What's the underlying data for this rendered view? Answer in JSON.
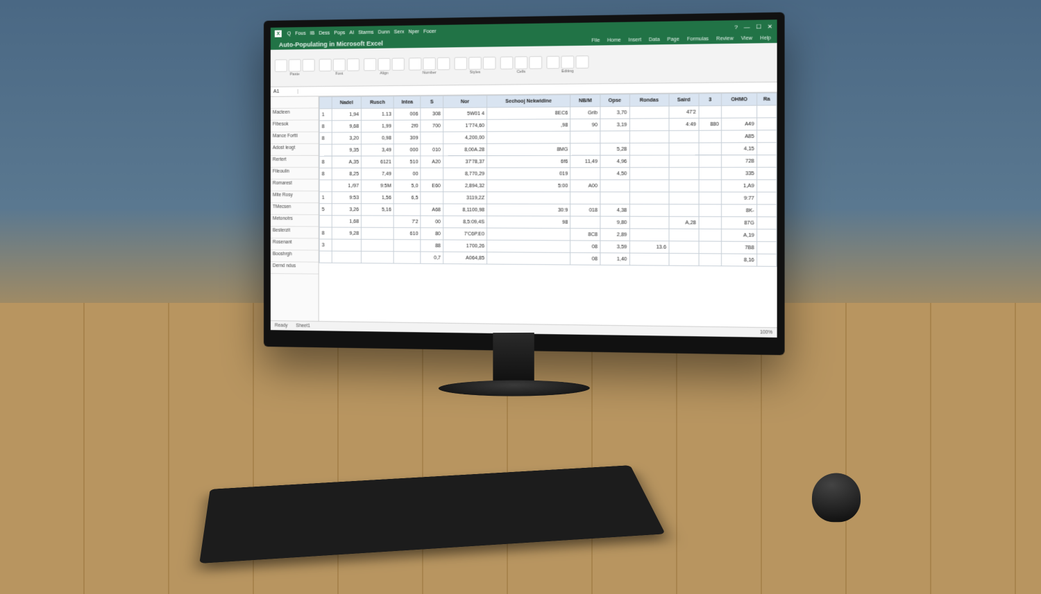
{
  "window": {
    "doc_title": "Auto-Populating in Microsoft Excel",
    "controls": {
      "min": "—",
      "max": "☐",
      "close": "✕",
      "help": "?"
    }
  },
  "menubar": [
    "File",
    "Home",
    "Insert",
    "Data",
    "Page",
    "Formulas",
    "Review",
    "View",
    "Help"
  ],
  "top_tabs": [
    "Q",
    "Fous",
    "IB",
    "Dess",
    "Pops",
    "AI",
    "Starms",
    "Dunn",
    "Serx",
    "Nper",
    "Focer"
  ],
  "ribbon": {
    "groups": [
      {
        "name": "clipboard",
        "label": "Paste"
      },
      {
        "name": "font",
        "label": "Font"
      },
      {
        "name": "align",
        "label": "Align"
      },
      {
        "name": "number",
        "label": "Number"
      },
      {
        "name": "styles",
        "label": "Styles"
      },
      {
        "name": "cells",
        "label": "Cells"
      },
      {
        "name": "editing",
        "label": "Editing"
      }
    ]
  },
  "formula_bar": {
    "cell_ref": "A1",
    "value": ""
  },
  "row_labels": [
    "Macteen",
    "Fibesok",
    "Mance Fortti",
    "Adost leogt",
    "Rertert",
    "Fileoulin",
    "Romarest",
    "Mite Rosy",
    "TMecsen",
    "Metonotrs",
    "Besterzit",
    "Rosenant",
    "Booshrgh",
    "Dernd ndus"
  ],
  "columns": [
    "",
    "Nadel",
    "Rusch",
    "Intea",
    "S",
    "Nor",
    "Sechooj Nekwidine",
    "NB/M",
    "Opse",
    "Rondas",
    "Saird",
    "3",
    "OHMO",
    "Ra"
  ],
  "rows": [
    [
      "1",
      "1,94",
      "1.13",
      "006",
      "308",
      "5W01 4",
      "8EC6",
      "Grib",
      "3,70",
      "",
      "47'2",
      "",
      ""
    ],
    [
      "8",
      "9,68",
      "1,99",
      "2f0",
      "700",
      "1'774,60",
      ",98",
      "90",
      "3,19",
      "",
      "4:49",
      "880",
      "A49"
    ],
    [
      "8",
      "3,20",
      "0,98",
      "309",
      "",
      "4,200,00",
      "",
      "",
      "",
      "",
      "",
      "",
      "A85"
    ],
    [
      "",
      "9,35",
      "3,49",
      "000",
      "010",
      "8,00A.28",
      "8MG",
      "",
      "5,28",
      "",
      "",
      "",
      "4,15"
    ],
    [
      "8",
      "A,35",
      "6121",
      "510",
      "A20",
      "37'78,37",
      "6f6",
      "11,49",
      "4,96",
      "",
      "",
      "",
      "728"
    ],
    [
      "8",
      "8,25",
      "7,49",
      "00",
      "",
      "8,770,29",
      "019",
      "",
      "4,50",
      "",
      "",
      "",
      "335"
    ],
    [
      "",
      "1,/97",
      "9:5M",
      "5,0",
      "E60",
      "2,894,32",
      "5:00",
      "A00",
      "",
      "",
      "",
      "",
      "1,A9"
    ],
    [
      "1",
      "9:53",
      "1,56",
      "6,5",
      "",
      "3119,2Z",
      "",
      "",
      "",
      "",
      "",
      "",
      "9:77"
    ],
    [
      "5",
      "3,26",
      "5,16",
      "",
      "A68",
      "8,1100,98",
      "30:9",
      "018",
      "4,38",
      "",
      "",
      "",
      "8K-"
    ],
    [
      "",
      "1,68",
      "",
      "7'2",
      "00",
      "8,5:09,4S",
      "98",
      "",
      "9,80",
      "",
      "A,28",
      "",
      "87G"
    ],
    [
      "8",
      "9,28",
      "",
      "610",
      "80",
      "7'C6P.E0",
      "",
      "8C8",
      "2,89",
      "",
      "",
      "",
      "A,19"
    ],
    [
      "3",
      "",
      "",
      "",
      "88",
      "1700,26",
      "",
      "08",
      "3,59",
      "13.6",
      "",
      "",
      "7B8"
    ],
    [
      "",
      "",
      "",
      "",
      "0,7",
      "A064,85",
      "",
      "08",
      "1,40",
      "",
      "",
      "",
      "8,16"
    ]
  ],
  "status": {
    "left": "Ready",
    "sheet": "Sheet1",
    "zoom": "100%"
  },
  "taskbar_colors": [
    "#0078d4",
    "#2b579a",
    "#217346",
    "#d83b01",
    "#7719aa",
    "#ffb900",
    "#c0392b",
    "#16a085"
  ]
}
